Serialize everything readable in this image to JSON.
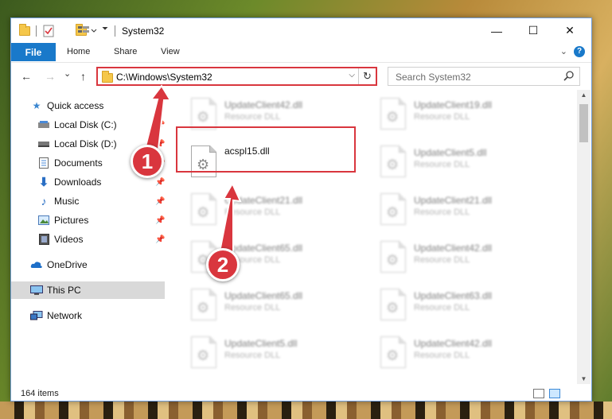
{
  "window": {
    "title": "System32",
    "minimize": "—",
    "maximize": "☐",
    "close": "✕"
  },
  "ribbon": {
    "tabs": [
      "File",
      "Home",
      "Share",
      "View"
    ],
    "help": "?"
  },
  "address": {
    "path": "C:\\Windows\\System32",
    "dropdown": "⌵",
    "refresh": "↻"
  },
  "search": {
    "placeholder": "Search System32"
  },
  "nav": {
    "back": "←",
    "forward": "→",
    "recent": "⌄",
    "up": "↑",
    "items": [
      {
        "label": "Quick access",
        "icon": "star-icon",
        "pinned": false
      },
      {
        "label": "Local Disk (C:)",
        "icon": "drive-icon",
        "pinned": true
      },
      {
        "label": "Local Disk (D:)",
        "icon": "drive-icon",
        "pinned": true
      },
      {
        "label": "Documents",
        "icon": "documents-icon",
        "pinned": true
      },
      {
        "label": "Downloads",
        "icon": "download-icon",
        "pinned": true
      },
      {
        "label": "Music",
        "icon": "music-icon",
        "pinned": true
      },
      {
        "label": "Pictures",
        "icon": "pictures-icon",
        "pinned": true
      },
      {
        "label": "Videos",
        "icon": "videos-icon",
        "pinned": true
      },
      {
        "label": "OneDrive",
        "icon": "cloud-icon",
        "pinned": false
      },
      {
        "label": "This PC",
        "icon": "pc-icon",
        "pinned": false
      },
      {
        "label": "Network",
        "icon": "network-icon",
        "pinned": false
      }
    ]
  },
  "files": {
    "left_column": [
      {
        "name": "UpdateClient42.dll",
        "type": "Resource DLL"
      },
      {
        "name": "acspl15.dll",
        "type": ""
      },
      {
        "name": "UpdateClient21.dll",
        "type": "Resource DLL"
      },
      {
        "name": "UpdateClient65.dll",
        "type": "Resource DLL"
      },
      {
        "name": "UpdateClient65.dll",
        "type": "Resource DLL"
      },
      {
        "name": "UpdateClient5.dll",
        "type": "Resource DLL"
      }
    ],
    "right_column": [
      {
        "name": "UpdateClient19.dll",
        "type": "Resource DLL"
      },
      {
        "name": "UpdateClient5.dll",
        "type": "Resource DLL"
      },
      {
        "name": "UpdateClient21.dll",
        "type": "Resource DLL"
      },
      {
        "name": "UpdateClient42.dll",
        "type": "Resource DLL"
      },
      {
        "name": "UpdateClient63.dll",
        "type": "Resource DLL"
      },
      {
        "name": "UpdateClient42.dll",
        "type": "Resource DLL"
      }
    ]
  },
  "status": {
    "count": "164 items"
  },
  "annotations": {
    "step1": "1",
    "step2": "2",
    "color": "#d9363e"
  }
}
